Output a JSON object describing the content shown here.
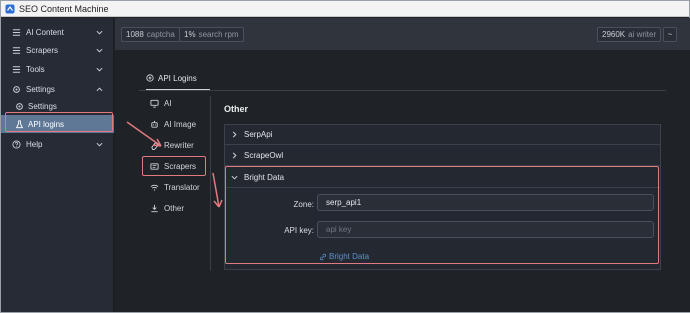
{
  "window": {
    "title": "SEO Content Machine"
  },
  "sidebar": {
    "items": [
      {
        "label": "AI Content",
        "icon": "list-icon",
        "expanded": false
      },
      {
        "label": "Scrapers",
        "icon": "list-icon",
        "expanded": false
      },
      {
        "label": "Tools",
        "icon": "list-icon",
        "expanded": false
      },
      {
        "label": "Settings",
        "icon": "gear-icon",
        "expanded": true
      },
      {
        "label": "Settings",
        "icon": "gear-icon",
        "sub": true
      },
      {
        "label": "API logins",
        "icon": "flask-icon",
        "sub": true,
        "active": true
      },
      {
        "label": "Help",
        "icon": "help-icon",
        "expanded": false
      }
    ]
  },
  "topbar": {
    "captcha_count": "1088",
    "captcha_label": "captcha",
    "search_rpm_value": "1%",
    "search_rpm_label": "search rpm",
    "writer_count": "2960K",
    "writer_label": "ai writer",
    "menu_label": "~"
  },
  "tabs": [
    {
      "label": "API Logins",
      "icon": "plus-circle-icon"
    }
  ],
  "subnav": [
    {
      "label": "AI",
      "icon": "monitor-icon"
    },
    {
      "label": "AI Image",
      "icon": "robot-icon"
    },
    {
      "label": "Rewriter",
      "icon": "eraser-icon"
    },
    {
      "label": "Scrapers",
      "icon": "scraper-icon",
      "highlighted": true
    },
    {
      "label": "Translator",
      "icon": "wifi-icon"
    },
    {
      "label": "Other",
      "icon": "download-icon"
    }
  ],
  "section": {
    "title": "Other"
  },
  "accordion": {
    "items": [
      {
        "label": "SerpApi",
        "expanded": false
      },
      {
        "label": "ScrapeOwl",
        "expanded": false
      },
      {
        "label": "Bright Data",
        "expanded": true
      }
    ],
    "bright_data": {
      "zone_label": "Zone:",
      "zone_value": "serp_api1",
      "api_key_label": "API key:",
      "api_key_placeholder": "api key",
      "link_label": "Bright Data"
    }
  },
  "colors": {
    "accent": "#5e7896",
    "highlight": "#e07a7e",
    "link": "#5f8fce"
  }
}
